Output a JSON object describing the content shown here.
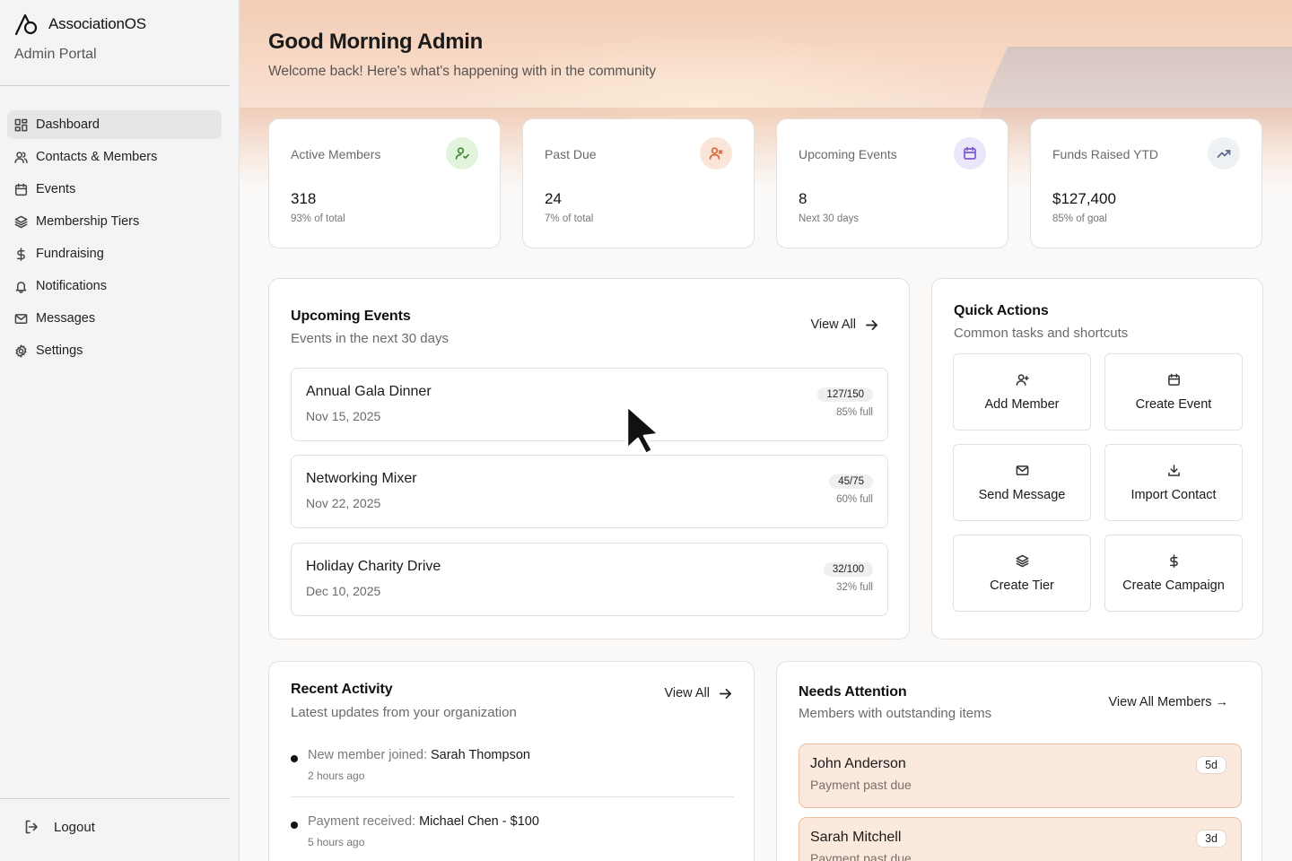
{
  "brand": {
    "name": "AssociationOS",
    "subtitle": "Admin Portal"
  },
  "nav": {
    "items": [
      {
        "label": "Dashboard",
        "icon": "grid-icon",
        "active": true
      },
      {
        "label": "Contacts & Members",
        "icon": "users-icon"
      },
      {
        "label": "Events",
        "icon": "calendar-icon"
      },
      {
        "label": "Membership Tiers",
        "icon": "layers-icon"
      },
      {
        "label": "Fundraising",
        "icon": "dollar-icon"
      },
      {
        "label": "Notifications",
        "icon": "bell-icon"
      },
      {
        "label": "Messages",
        "icon": "mail-icon"
      },
      {
        "label": "Settings",
        "icon": "gear-icon"
      }
    ],
    "logout": "Logout"
  },
  "header": {
    "greeting": "Good Morning Admin",
    "welcome": "Welcome back! Here's what's happening with in the community"
  },
  "stats": [
    {
      "label": "Active Members",
      "value": "318",
      "sub": "93% of total",
      "icon": "user-check-icon",
      "color": "#3f8a3a",
      "bg": "#e3f4dd"
    },
    {
      "label": "Past Due",
      "value": "24",
      "sub": "7% of total",
      "icon": "user-x-icon",
      "color": "#d9683a",
      "bg": "#fbe4d8"
    },
    {
      "label": "Upcoming Events",
      "value": "8",
      "sub": "Next 30 days",
      "icon": "calendar-icon",
      "color": "#7a5ad0",
      "bg": "#ece6fa"
    },
    {
      "label": "Funds Raised YTD",
      "value": "$127,400",
      "sub": "85% of goal",
      "icon": "trending-up-icon",
      "color": "#5a6a8a",
      "bg": "#eef1f3"
    }
  ],
  "upcoming": {
    "title": "Upcoming Events",
    "subtitle": "Events in the next 30 days",
    "view_all": "View All",
    "events": [
      {
        "name": "Annual Gala Dinner",
        "date": "Nov 15, 2025",
        "capacity": "127/150",
        "pct": "85% full"
      },
      {
        "name": "Networking Mixer",
        "date": "Nov 22, 2025",
        "capacity": "45/75",
        "pct": "60% full"
      },
      {
        "name": "Holiday Charity Drive",
        "date": "Dec 10, 2025",
        "capacity": "32/100",
        "pct": "32% full"
      }
    ]
  },
  "quick_actions": {
    "title": "Quick Actions",
    "subtitle": "Common tasks and shortcuts",
    "items": [
      {
        "label": "Add Member",
        "icon": "user-plus-icon"
      },
      {
        "label": "Create Event",
        "icon": "calendar-icon"
      },
      {
        "label": "Send Message",
        "icon": "mail-icon"
      },
      {
        "label": "Import Contact",
        "icon": "download-icon"
      },
      {
        "label": "Create Tier",
        "icon": "layers-icon"
      },
      {
        "label": "Create Campaign",
        "icon": "dollar-icon"
      }
    ]
  },
  "activity": {
    "title": "Recent Activity",
    "subtitle": "Latest updates from your organization",
    "view_all": "View All",
    "items": [
      {
        "action": "New member joined:",
        "subject": "Sarah Thompson",
        "time": "2 hours ago"
      },
      {
        "action": "Payment received:",
        "subject": "Michael Chen - $100",
        "time": "5 hours ago"
      }
    ]
  },
  "attention": {
    "title": "Needs Attention",
    "subtitle": "Members with outstanding items",
    "view_all": "View All Members →",
    "items": [
      {
        "name": "John Anderson",
        "reason": "Payment past due",
        "days": "5d"
      },
      {
        "name": "Sarah Mitchell",
        "reason": "Payment past due",
        "days": "3d"
      }
    ]
  }
}
